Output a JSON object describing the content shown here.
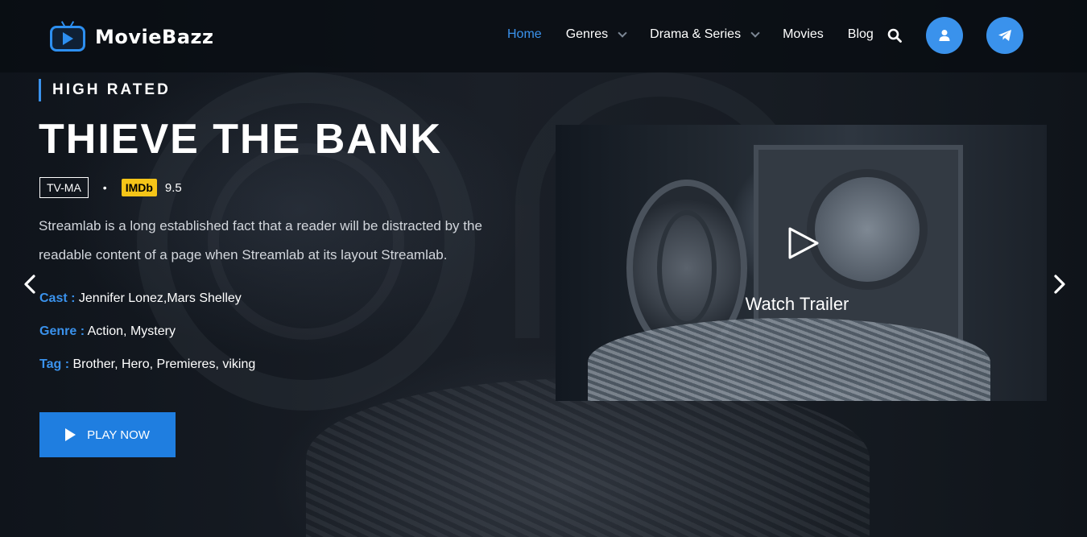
{
  "brand": {
    "name": "MovieBazz",
    "accent": "#3a92ec"
  },
  "nav": {
    "items": [
      {
        "label": "Home",
        "active": true
      },
      {
        "label": "Genres",
        "dropdown": true
      },
      {
        "label": "Drama & Series",
        "dropdown": true
      },
      {
        "label": "Movies"
      },
      {
        "label": "Blog"
      }
    ],
    "icons": [
      "search-icon",
      "user-icon",
      "telegram-icon"
    ]
  },
  "hero": {
    "eyebrow": "HIGH RATED",
    "title": "THIEVE THE BANK",
    "rating": "TV-MA",
    "separator": "•",
    "imdb_label": "IMDb",
    "imdb_score": "9.5",
    "description": "Streamlab is a long established fact that a reader will be distracted by the readable content of a page when Streamlab at its layout Streamlab.",
    "cast_label": "Cast :",
    "cast_value": "Jennifer Lonez,Mars Shelley",
    "genre_label": "Genre :",
    "genre_value": "Action, Mystery",
    "tag_label": "Tag :",
    "tag_value": "Brother, Hero, Premieres, viking",
    "play_label": "PLAY NOW",
    "trailer_label": "Watch Trailer"
  },
  "colors": {
    "imdb": "#f5c518",
    "button": "#1f7ee0"
  }
}
